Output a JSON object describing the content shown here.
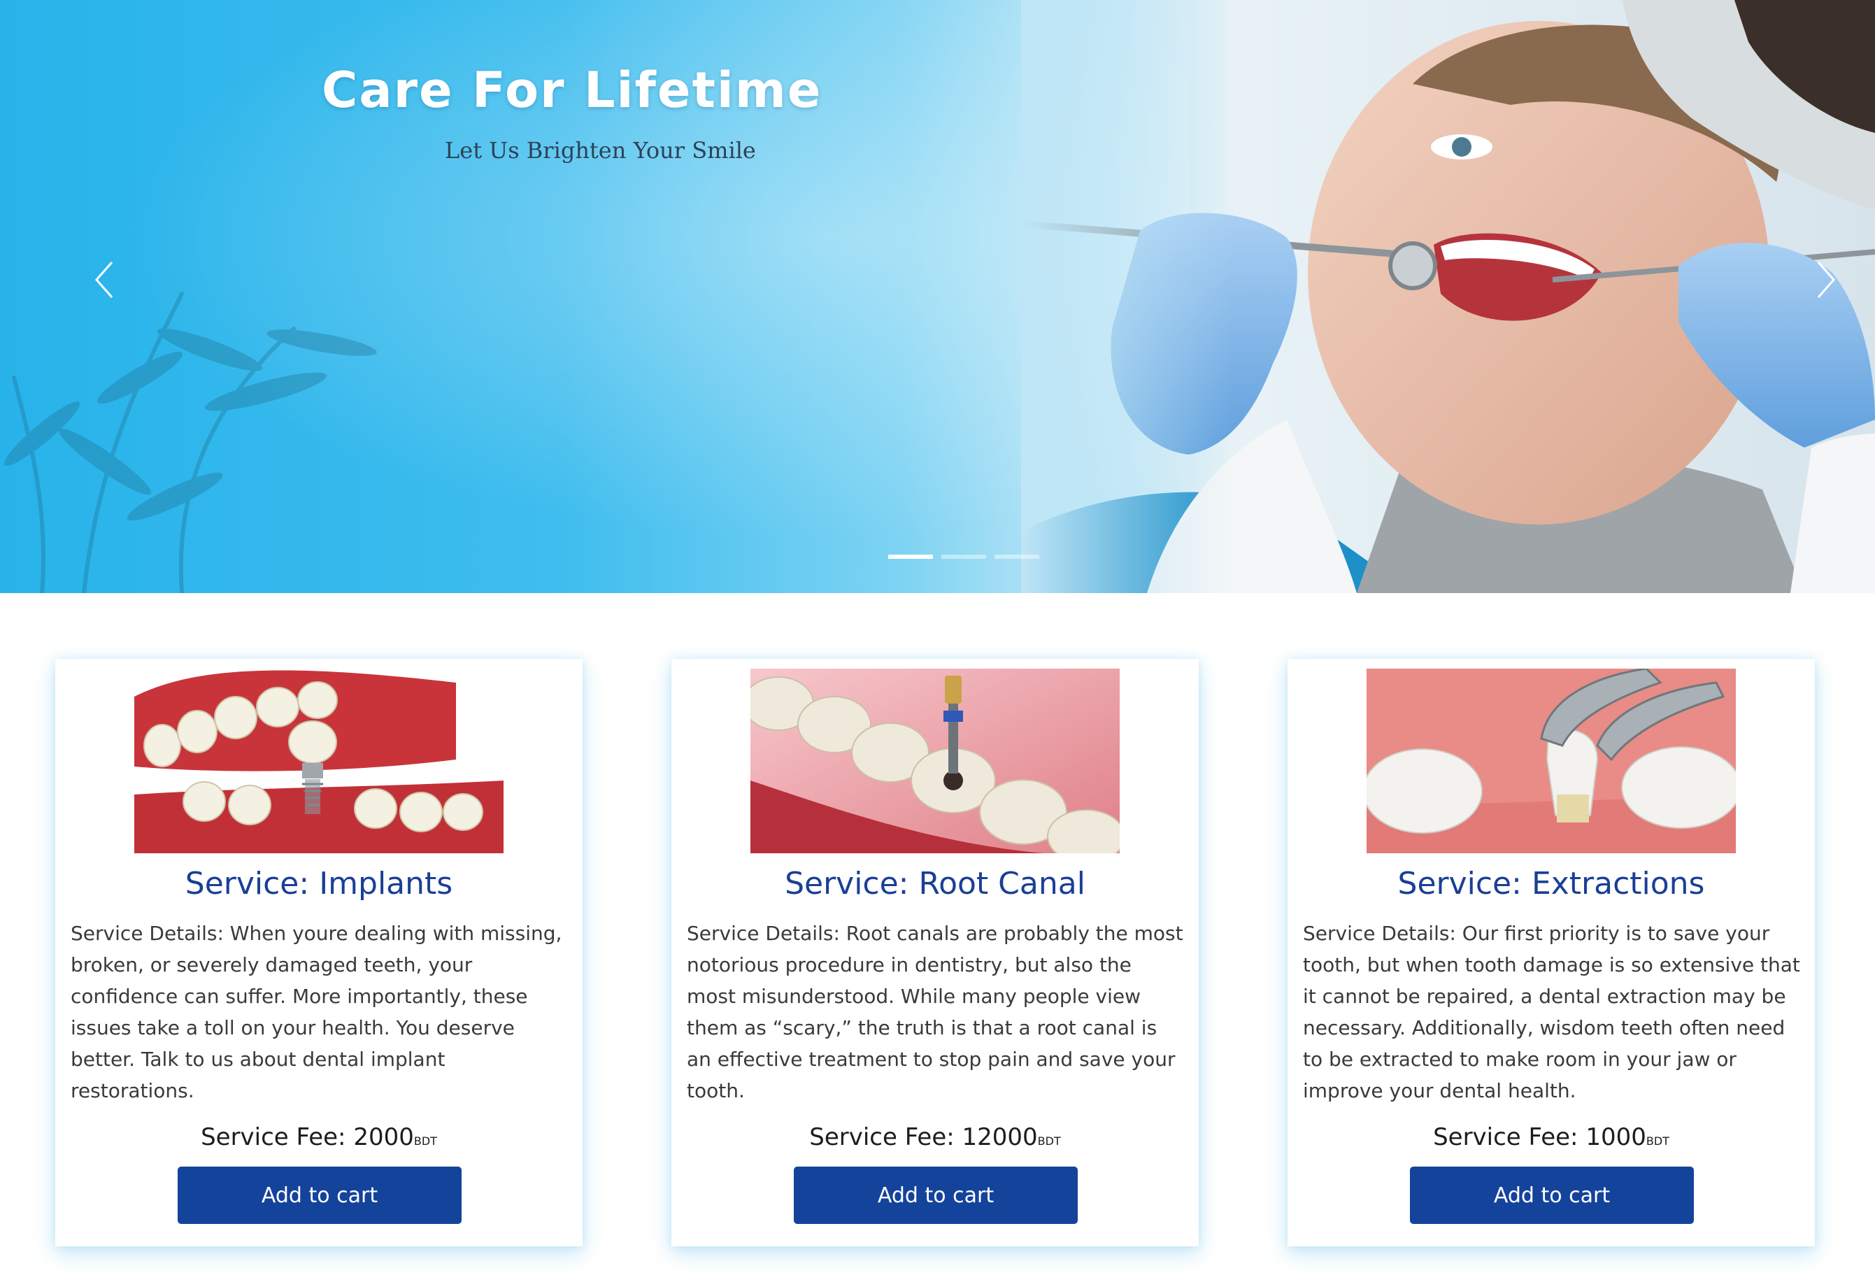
{
  "hero": {
    "title": "Care For Lifetime",
    "subtitle": "Let Us Brighten Your Smile",
    "slides_count": 3,
    "active_slide": 1
  },
  "services": [
    {
      "title": "Service: Implants",
      "details": "Service Details: When youre dealing with missing, broken, or severely damaged teeth, your confidence can suffer. More importantly, these issues take a toll on your health. You deserve better. Talk to us about dental implant restorations.",
      "fee_label": "Service Fee: ",
      "fee_value": "2000",
      "fee_unit": "BDT",
      "button": "Add to cart"
    },
    {
      "title": "Service: Root Canal",
      "details": "Service Details: Root canals are probably the most notorious procedure in dentistry, but also the most misunderstood. While many people view them as “scary,” the truth is that a root canal is an effective treatment to stop pain and save your tooth.",
      "fee_label": "Service Fee: ",
      "fee_value": "12000",
      "fee_unit": "BDT",
      "button": "Add to cart"
    },
    {
      "title": "Service: Extractions",
      "details": "Service Details: Our first priority is to save your tooth, but when tooth damage is so extensive that it cannot be repaired, a dental extraction may be necessary. Additionally, wisdom teeth often need to be extracted to make room in your jaw or improve your dental health.",
      "fee_label": "Service Fee: ",
      "fee_value": "1000",
      "fee_unit": "BDT",
      "button": "Add to cart"
    }
  ],
  "colors": {
    "brand_blue": "#14439b",
    "title_blue": "#1a3f96",
    "hero_blue": "#27b3ea"
  }
}
